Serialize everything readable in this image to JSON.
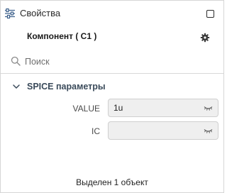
{
  "header": {
    "title": "Свойства",
    "icon": "sliders-icon",
    "window_button_icon": "square-icon"
  },
  "component": {
    "name": "Компонент ( C1 )",
    "settings_icon": "gear-icon"
  },
  "search": {
    "placeholder": "Поиск",
    "value": "",
    "icon": "search-icon"
  },
  "section": {
    "title": "SPICE параметры",
    "expanded": true,
    "icon": "chevron-down-icon",
    "params": [
      {
        "label": "VALUE",
        "value": "1u",
        "icon": "eye-closed-icon"
      },
      {
        "label": "IC",
        "value": "",
        "icon": "eye-closed-icon"
      }
    ]
  },
  "status": {
    "text": "Выделен 1 объект"
  },
  "colors": {
    "section_title": "#3a4a5a",
    "field_bg": "#efefef",
    "border": "#d6d6d6"
  }
}
